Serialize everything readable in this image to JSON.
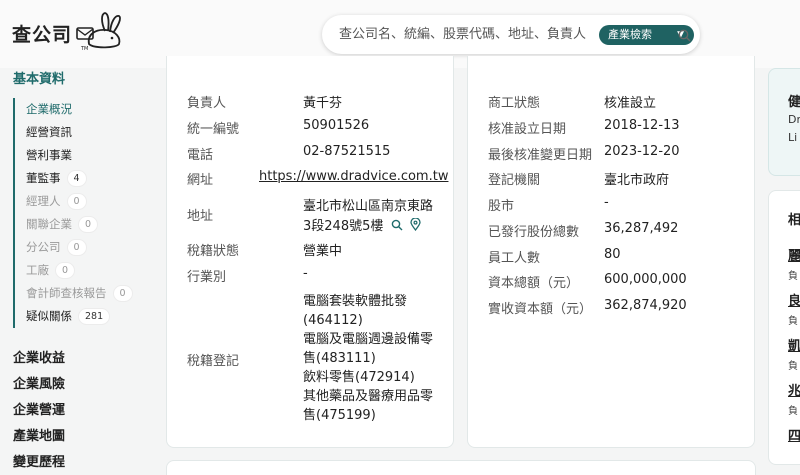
{
  "header": {
    "logo_text": "查公司",
    "search_placeholder": "查公司名、統編、股票代碼、地址、負責人",
    "search_type": "產業檢索"
  },
  "sidebar": {
    "section_title": "基本資料",
    "sub_items": [
      {
        "label": "企業概況",
        "state": "active"
      },
      {
        "label": "經營資訊",
        "state": "normal"
      },
      {
        "label": "營利事業",
        "state": "normal"
      },
      {
        "label": "董監事",
        "count": "4",
        "state": "normal"
      },
      {
        "label": "經理人",
        "count": "0",
        "state": "muted"
      },
      {
        "label": "關聯企業",
        "count": "0",
        "state": "muted"
      },
      {
        "label": "分公司",
        "count": "0",
        "state": "muted"
      },
      {
        "label": "工廠",
        "count": "0",
        "state": "muted"
      },
      {
        "label": "會計師查核報告",
        "count": "0",
        "state": "muted"
      },
      {
        "label": "疑似關係",
        "count": "281",
        "state": "normal"
      }
    ],
    "nav": [
      "企業收益",
      "企業風險",
      "企業營運",
      "產業地圖",
      "變更歷程"
    ]
  },
  "card1": {
    "responsible_label": "負責人",
    "responsible_value": "黃千芬",
    "taxid_label": "統一編號",
    "taxid_value": "50901526",
    "phone_label": "電話",
    "phone_value": "02-87521515",
    "website_label": "網址",
    "website_value": "https://www.dradvice.com.tw",
    "address_label": "地址",
    "address_line1": "臺北市松山區南京東路",
    "address_line2": "3段248號5樓",
    "tax_status_label": "稅籍狀態",
    "tax_status_value": "營業中",
    "industry_label": "行業別",
    "industry_value": "-",
    "tax_reg_label": "稅籍登記",
    "tax_reg_lines": [
      "電腦套裝軟體批發",
      "(464112)",
      "電腦及電腦週邊設備零",
      "售(483111)",
      "飲料零售(472914)",
      "其他藥品及醫療用品零",
      "售(475199)"
    ]
  },
  "card2": {
    "rows": [
      {
        "label": "商工狀態",
        "value": "核准設立"
      },
      {
        "label": "核准設立日期",
        "value": "2018-12-13"
      },
      {
        "label": "最後核准變更日期",
        "value": "2023-12-20"
      },
      {
        "label": "登記機關",
        "value": "臺北市政府"
      },
      {
        "label": "股市",
        "value": "-"
      },
      {
        "label": "已發行股份總數",
        "value": "36,287,492"
      },
      {
        "label": "員工人數",
        "value": "80"
      },
      {
        "label": "資本總額（元）",
        "value": "600,000,000"
      },
      {
        "label": "實收資本額（元）",
        "value": "362,874,920"
      }
    ]
  },
  "right_panel": {
    "top_title": "健",
    "top_line1": "Dr",
    "top_line2": "Li",
    "list_title": "相",
    "links": [
      {
        "title": "麗",
        "sub": "負"
      },
      {
        "title": "良",
        "sub": "負"
      },
      {
        "title": "凱",
        "sub": "負"
      },
      {
        "title": "兆",
        "sub": "負"
      },
      {
        "title": "四",
        "sub": ""
      }
    ]
  },
  "colors": {
    "accent": "#1f6b6b",
    "muted": "#9a9a9a",
    "background": "#f4f5f5"
  }
}
